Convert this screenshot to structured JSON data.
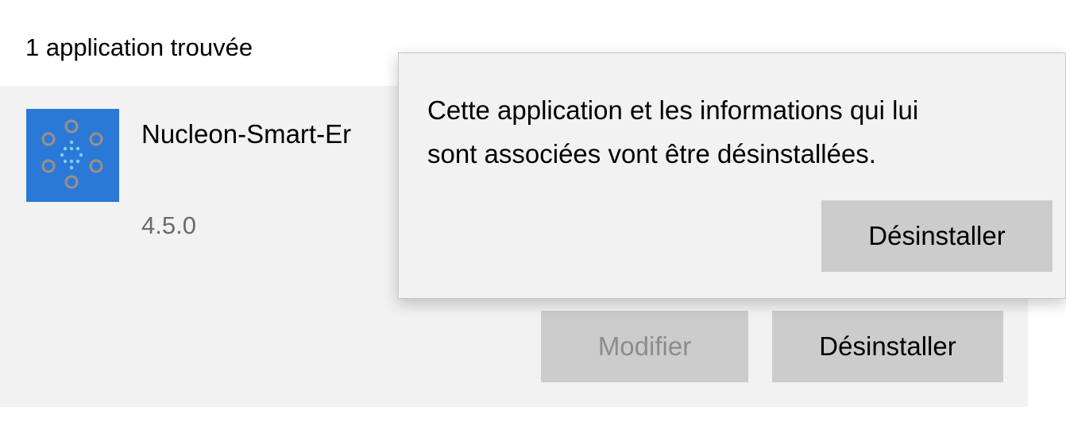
{
  "results": {
    "count_label": "1 application trouvée"
  },
  "app": {
    "name": "Nucleon-Smart-Er",
    "version": "4.5.0",
    "icon": "nucleon-app-icon",
    "icon_bg_color": "#2b79d6"
  },
  "actions": {
    "modify_label": "Modifier",
    "uninstall_label": "Désinstaller"
  },
  "flyout": {
    "message_line1": "Cette application et les informations qui lui",
    "message_line2": "sont associées vont être désinstallées.",
    "confirm_label": "Désinstaller"
  }
}
